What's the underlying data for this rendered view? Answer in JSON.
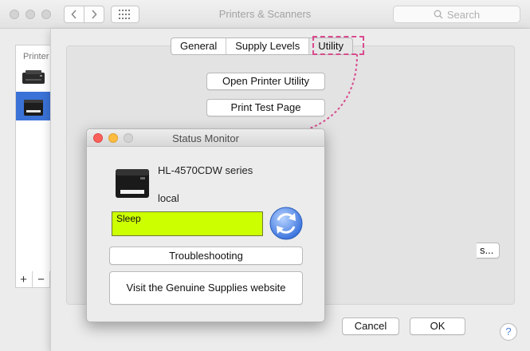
{
  "window": {
    "title": "Printers & Scanners",
    "search_placeholder": "Search"
  },
  "printer_list": {
    "header": "Printer",
    "add_label": "+",
    "remove_label": "−"
  },
  "tabs": [
    {
      "label": "General"
    },
    {
      "label": "Supply Levels"
    },
    {
      "label": "Utility"
    }
  ],
  "sheet": {
    "open_utility_label": "Open Printer Utility",
    "print_test_label": "Print Test Page",
    "options_label": "s...",
    "cancel_label": "Cancel",
    "ok_label": "OK",
    "help_label": "?"
  },
  "status_monitor": {
    "title": "Status Monitor",
    "printer_name": "HL-4570CDW series",
    "connection": "local",
    "status": "Sleep",
    "status_color": "#ccff00",
    "troubleshooting_label": "Troubleshooting",
    "supplies_label": "Visit the Genuine Supplies website"
  },
  "colors": {
    "accent": "#3a72d7",
    "annotation": "#d94b8f"
  }
}
